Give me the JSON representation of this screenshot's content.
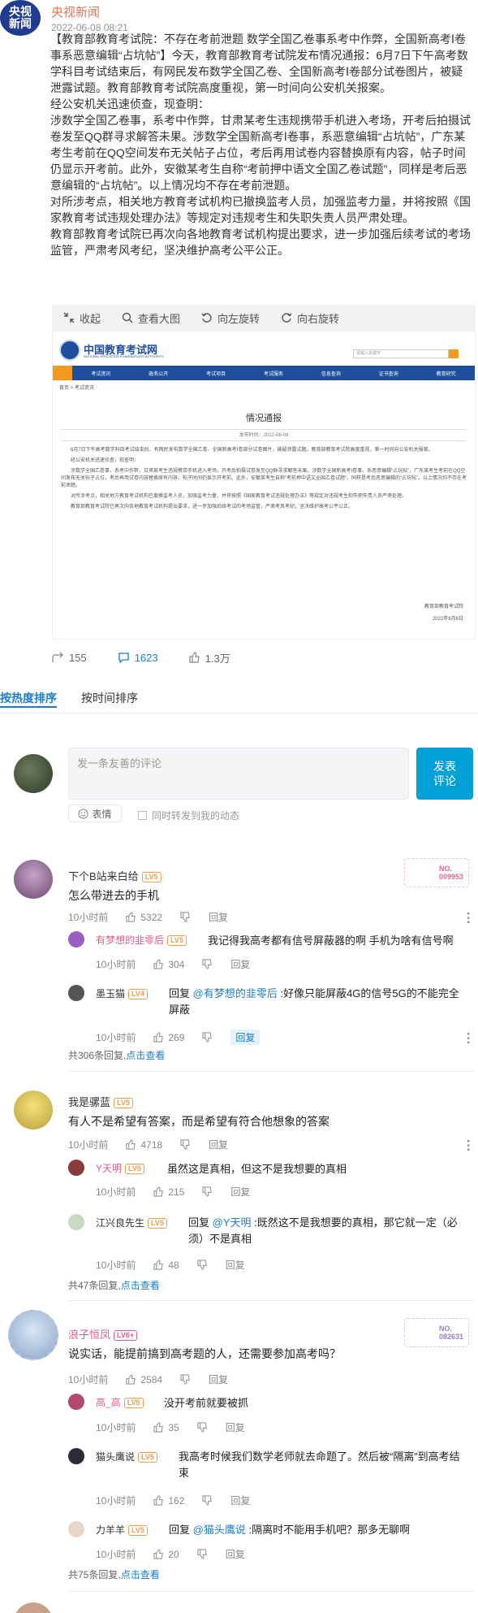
{
  "post": {
    "avatar_text": "央视\n新闻",
    "author": "央视新闻",
    "time": "2022-06-08 08:21",
    "paragraphs": [
      "【教育部教育考试院：不存在考前泄题 数学全国乙卷事系考中作弊，全国新高考Ⅰ卷事系恶意编辑“占坑帖”】今天，教育部教育考试院发布情况通报：6月7日下午高考数学科目考试结束后，有网民发布数学全国乙卷、全国新高考Ⅰ卷部分试卷图片，被疑泄露试题。教育部教育考试院高度重视，第一时间向公安机关报案。",
      "经公安机关迅速侦查，现查明：",
      "涉数学全国乙卷事，系考中作弊，甘肃某考生违规携带手机进入考场，开考后拍摄试卷发至QQ群寻求解答未果。涉数学全国新高考Ⅰ卷事，系恶意编辑“占坑帖”，广东某考生考前在QQ空间发布无关帖子占位，考后再用试卷内容替换原有内容，帖子时间仍显示开考前。此外，安徽某考生自称“考前押中语文全国乙卷试题”，同样是考后恶意编辑的“占坑帖”。以上情况均不存在考前泄题。",
      "对所涉考点，相关地方教育考试机构已撤换监考人员，加强监考力量，并将按照《国家教育考试违规处理办法》等规定对违规考生和失职失责人员严肃处理。",
      "教育部教育考试院已再次向各地教育考试机构提出要求，进一步加强后续考试的考场监管，严肃考风考纪，坚决维护高考公平公正。"
    ],
    "toolbar": {
      "collapse": "收起",
      "view_large": "查看大图",
      "rotate_left": "向左旋转",
      "rotate_right": "向右旋转"
    },
    "doc": {
      "site_name": "中国教育考试网",
      "site_sub": "NATIONAL EDUCATION EXAMINATIONS AUTHORITY",
      "search_placeholder": "请输入关键字",
      "nav": [
        "首页",
        "考试资讯",
        "政务公开",
        "考试项目",
        "考试服务",
        "信息查询",
        "证书查询",
        "教育研究"
      ],
      "breadcrumb": "首页 > 考试资讯",
      "title": "情况通报",
      "meta": "发布时间：2022-06-08",
      "paras": [
        "6月7日下午高考数学科目考试结束后，有网民发布数学全国乙卷、全国新高考Ⅰ卷部分试卷图片，被疑泄露试题。教育部教育考试院高度重视，第一时间向公安机关报案。",
        "经公安机关迅速侦查，现查明：",
        "涉数学全国乙卷事，系考中作弊，甘肃某考生违规携带手机进入考场，开考后拍摄试卷发至QQ群寻求解答未果。涉数学全国新高考Ⅰ卷事，系恶意编辑“占坑帖”，广东某考生考前在QQ空间发布无关帖子占位，考后再用试卷内容替换原有内容，帖子时间仍显示开考前。此外，安徽某考生自称“考前押中语文全国乙卷试题”，同样是考后恶意编辑的“占坑帖”。以上情况均不存在考前泄题。",
        "对所涉考点，相关地方教育考试机构已撤换监考人员，加强监考力量，并将按照《国家教育考试违规处理办法》等规定对违规考生和失职失责人员严肃处理。",
        "教育部教育考试院已再次向各地教育考试机构提出要求，进一步加强后续考试的考场监管，严肃考风考纪，坚决维护高考公平公正。"
      ],
      "sign": "教育部教育考试院",
      "date": "2022年6月8日"
    },
    "stats": {
      "reposts": "155",
      "comments": "1623",
      "likes": "1.3万"
    }
  },
  "tabs": {
    "hot": "按热度排序",
    "time": "按时间排序"
  },
  "compose": {
    "placeholder": "发一条友善的评论",
    "submit": "发表\n评论",
    "emoji": "表情",
    "sync": "同时转发到我的动态"
  },
  "comments": [
    {
      "name": "下个B站来白给",
      "level": "LV5",
      "text": "怎么带进去的手机",
      "time": "10小时前",
      "likes": "5322",
      "reply": "回复",
      "badge": "NO.\n009953",
      "replies": [
        {
          "name": "有梦想的韭零后",
          "level": "LV5",
          "text": "我记得我高考都有信号屏蔽器的啊 手机为啥有信号啊",
          "time": "10小时前",
          "likes": "304",
          "reply": "回复"
        },
        {
          "name": "墨玉猫",
          "level": "LV4",
          "prefix": "回复",
          "mention": "@有梦想的韭零后",
          "text": ":好像只能屏蔽4G的信号5G的不能完全屏蔽",
          "time": "10小时前",
          "likes": "269",
          "reply": "回复"
        }
      ],
      "count": "共306条回复,",
      "more": "点击查看"
    },
    {
      "name": "我是骡蓝",
      "level": "LV5",
      "text": "有人不是希望有答案，而是希望有符合他想象的答案",
      "time": "10小时前",
      "likes": "4718",
      "reply": "回复",
      "replies": [
        {
          "name": "Y天明",
          "level": "LV5",
          "text": "虽然这是真相，但这不是我想要的真相",
          "time": "10小时前",
          "likes": "215",
          "reply": "回复"
        },
        {
          "name": "江兴良先生",
          "level": "LV5",
          "prefix": "回复",
          "mention": "@Y天明",
          "text": ":既然这不是我想要的真相，那它就一定（必须）不是真相",
          "time": "10小时前",
          "likes": "48",
          "reply": "回复"
        }
      ],
      "count": "共47条回复,",
      "more": "点击查看"
    },
    {
      "name": "浪子恒凤",
      "level": "LV6+",
      "text": "说实话，能提前搞到高考题的人，还需要参加高考吗？",
      "time": "10小时前",
      "likes": "2584",
      "reply": "回复",
      "badge": "NO.\n082631",
      "replies": [
        {
          "name": "高_高",
          "level": "LV5",
          "text": "没开考前就要被抓",
          "time": "10小时前",
          "likes": "35",
          "reply": "回复"
        },
        {
          "name": "猫头鹰说",
          "level": "LV5",
          "text": "我高考时候我们数学老师就去命题了。然后被“隔离”到高考结束",
          "time": "10小时前",
          "likes": "162",
          "reply": "回复"
        },
        {
          "name": "力羊羊",
          "level": "LV5",
          "prefix": "回复",
          "mention": "@猫头鹰说",
          "text": ":隔离时不能用手机吧？那多无聊啊",
          "time": "10小时前",
          "likes": "20",
          "reply": "回复"
        }
      ],
      "count": "共75条回复,",
      "more": "点击查看"
    }
  ]
}
